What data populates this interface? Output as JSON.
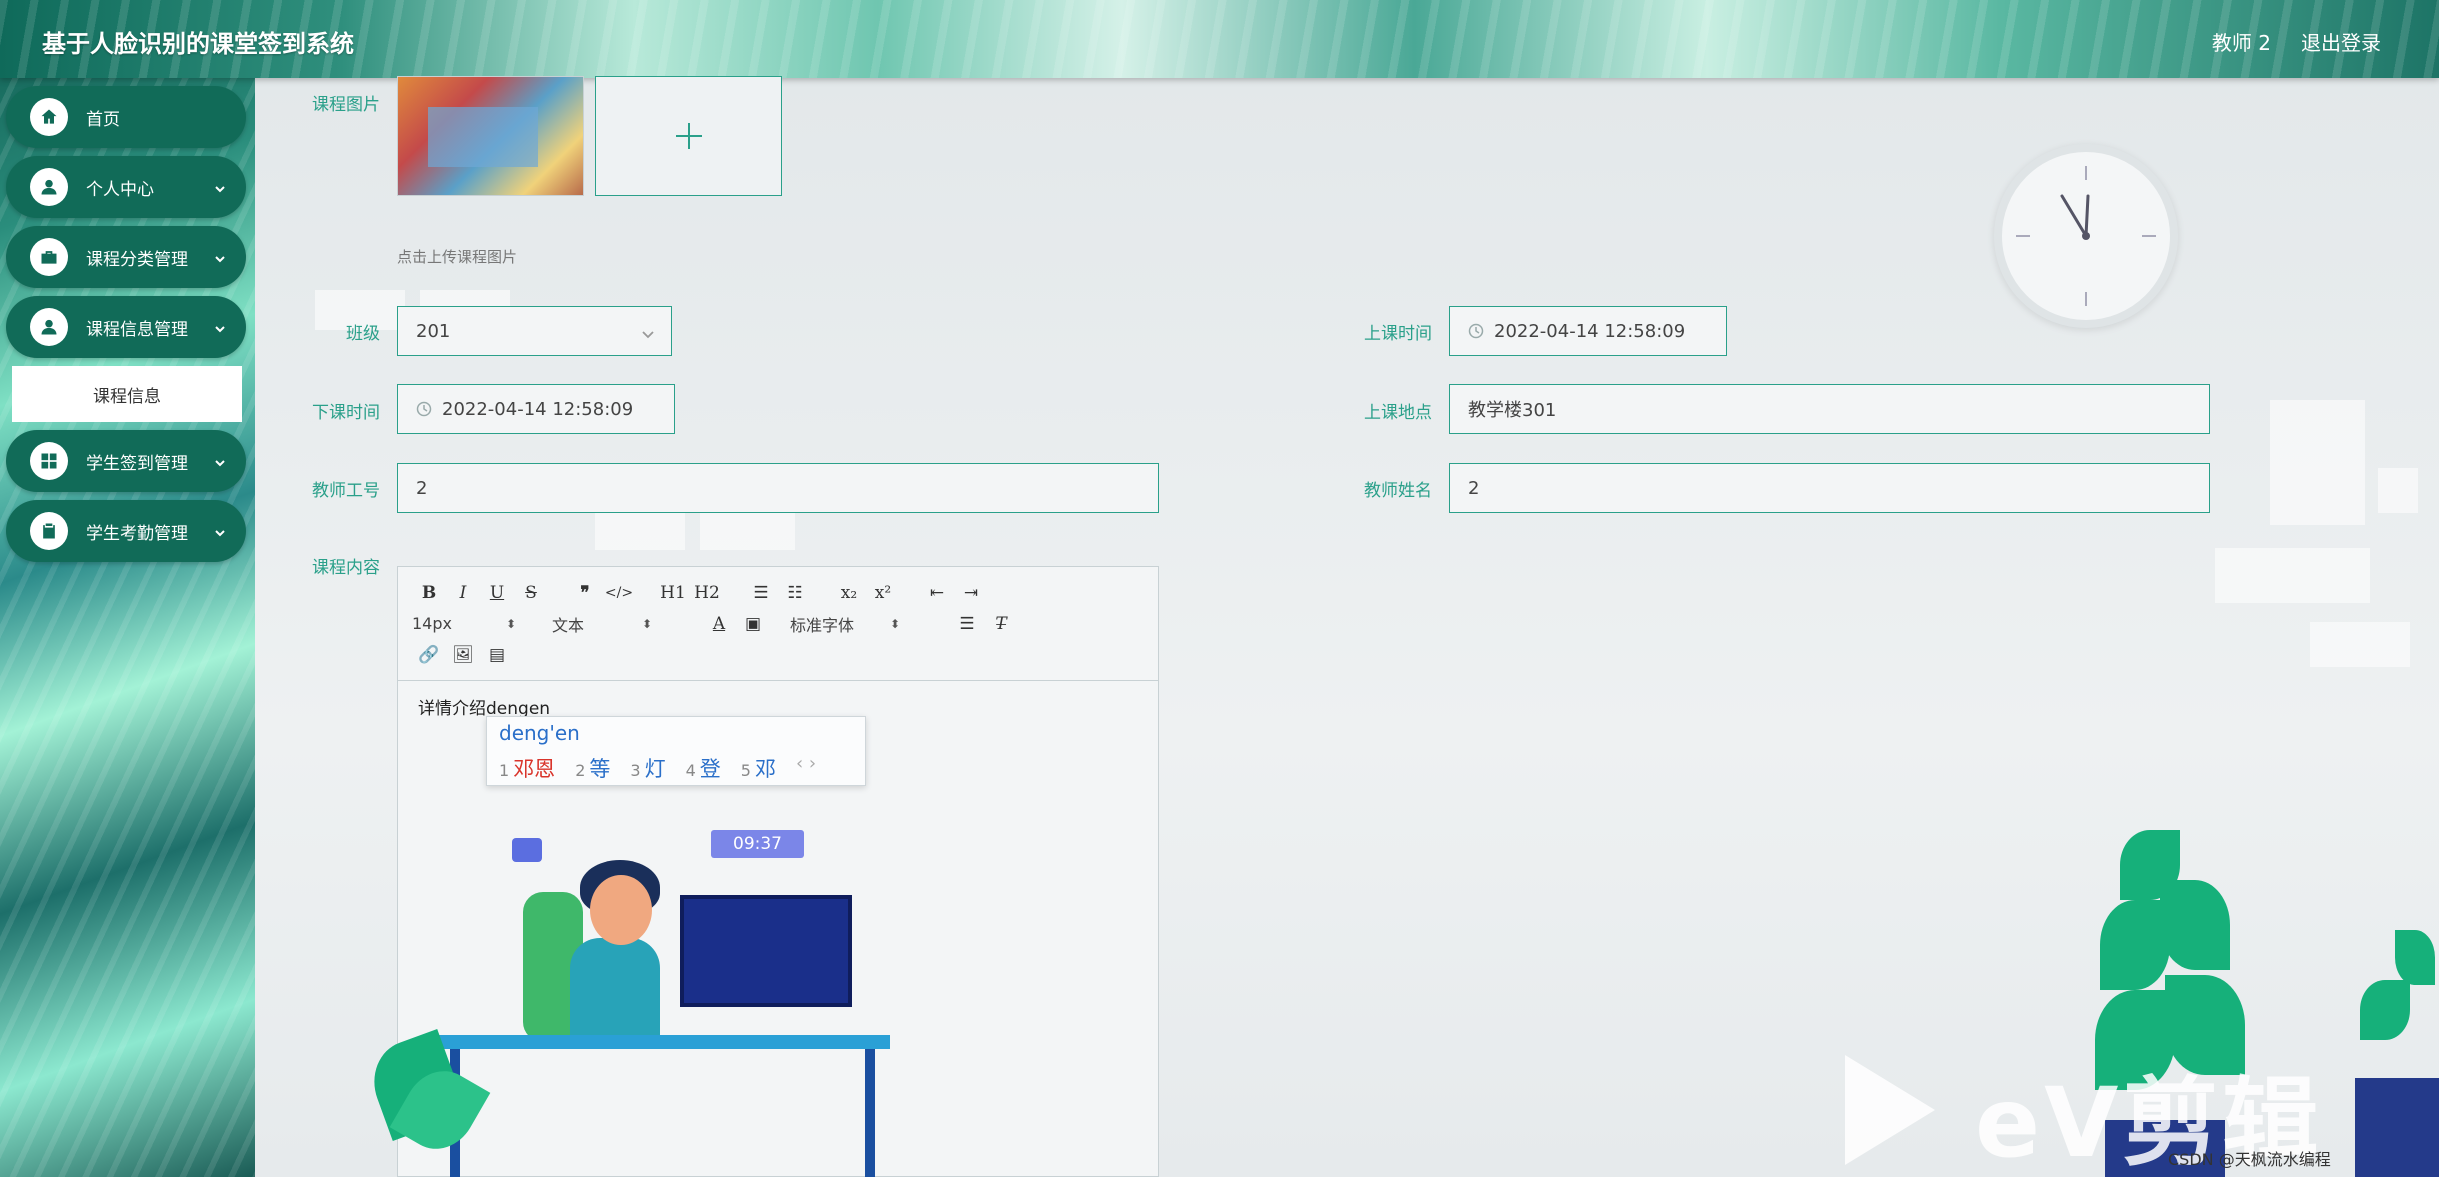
{
  "header": {
    "app_title": "基于人脸识别的课堂签到系统",
    "user_label": "教师 2",
    "logout_label": "退出登录"
  },
  "sidebar": {
    "items": [
      {
        "label": "首页",
        "icon": "home-icon",
        "expandable": false
      },
      {
        "label": "个人中心",
        "icon": "user-icon",
        "expandable": true
      },
      {
        "label": "课程分类管理",
        "icon": "briefcase-icon",
        "expandable": true
      },
      {
        "label": "课程信息管理",
        "icon": "user-icon",
        "expandable": true
      },
      {
        "label": "学生签到管理",
        "icon": "grid-icon",
        "expandable": true
      },
      {
        "label": "学生考勤管理",
        "icon": "clipboard-icon",
        "expandable": true
      }
    ],
    "sub_item_label": "课程信息"
  },
  "form": {
    "course_image_label": "课程图片",
    "upload_hint": "点击上传课程图片",
    "class_label": "班级",
    "class_value": "201",
    "start_time_label": "上课时间",
    "start_time_value": "2022-04-14 12:58:09",
    "end_time_label": "下课时间",
    "end_time_value": "2022-04-14 12:58:09",
    "location_label": "上课地点",
    "location_value": "教学楼301",
    "teacher_id_label": "教师工号",
    "teacher_id_value": "2",
    "teacher_name_label": "教师姓名",
    "teacher_name_value": "2",
    "content_label": "课程内容"
  },
  "editor": {
    "font_size": "14px",
    "format": "文本",
    "font_family": "标准字体",
    "content_text": "详情介绍dengen",
    "h1": "H1",
    "h2": "H2",
    "sub": "x₂",
    "sup": "x²"
  },
  "ime": {
    "composition": "deng'en",
    "candidates": [
      {
        "num": "1",
        "text": "邓恩"
      },
      {
        "num": "2",
        "text": "等"
      },
      {
        "num": "3",
        "text": "灯"
      },
      {
        "num": "4",
        "text": "登"
      },
      {
        "num": "5",
        "text": "邓"
      }
    ]
  },
  "illustration": {
    "time_badge": "09:37"
  },
  "watermark": {
    "text": "eV剪辑",
    "csdn": "CSDN @天枫流水编程"
  },
  "colors": {
    "accent": "#2aa08a",
    "sidebar_bg": "#116b58",
    "ime_first": "#d9342b",
    "ime_text": "#2a6fc9"
  }
}
